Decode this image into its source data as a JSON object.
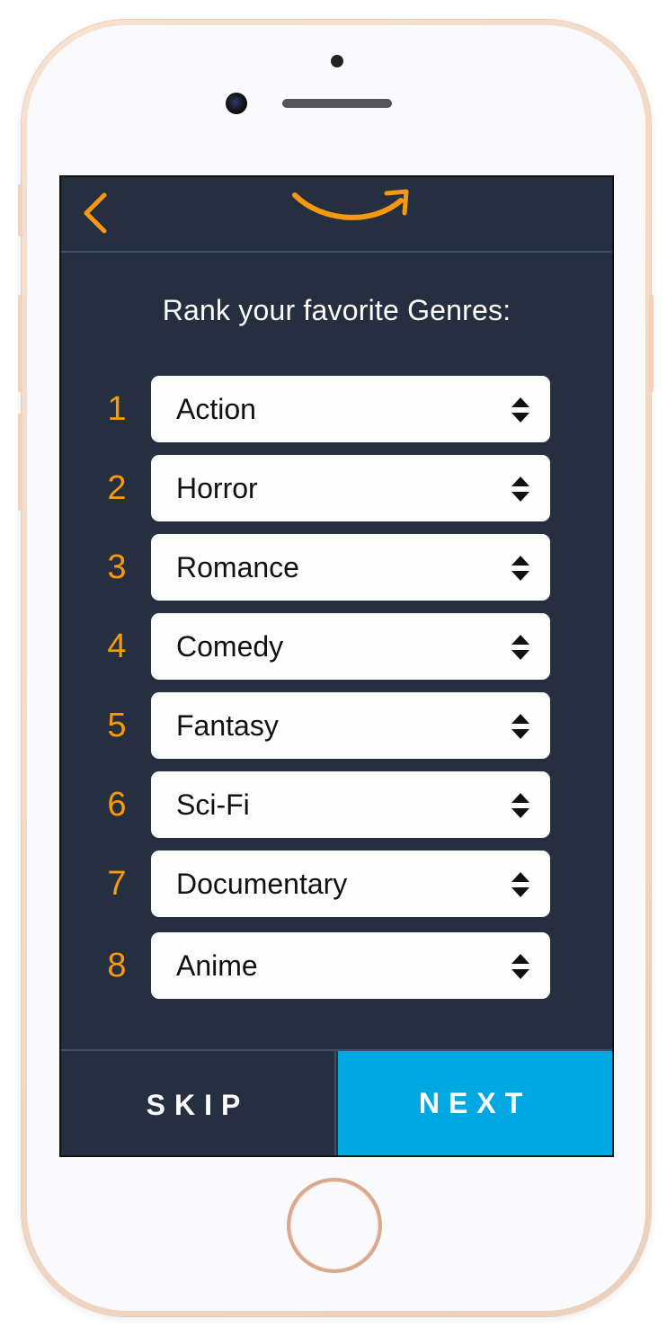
{
  "header": {
    "back_icon": "chevron-left-icon",
    "logo_icon": "smile-arrow-logo",
    "accent_color": "#f7990c"
  },
  "title": "Rank your favorite Genres:",
  "rankings": [
    {
      "rank": "1",
      "genre": "Action"
    },
    {
      "rank": "2",
      "genre": "Horror"
    },
    {
      "rank": "3",
      "genre": "Romance"
    },
    {
      "rank": "4",
      "genre": "Comedy"
    },
    {
      "rank": "5",
      "genre": "Fantasy"
    },
    {
      "rank": "6",
      "genre": "Sci-Fi"
    },
    {
      "rank": "7",
      "genre": "Documentary"
    },
    {
      "rank": "8",
      "genre": "Anime"
    }
  ],
  "footer": {
    "skip_label": "SKIP",
    "next_label": "NEXT",
    "next_color": "#00a8e1"
  }
}
